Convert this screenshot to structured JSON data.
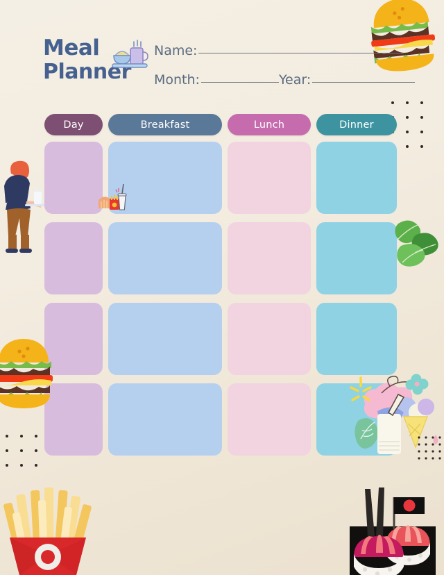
{
  "page": {
    "background_color": "#f2ece0",
    "title_color": "#46618f",
    "label_color": "#5a6b80",
    "rule_color": "#6a6f78"
  },
  "header": {
    "title_line1": "Meal",
    "title_line2": "Planner",
    "logo_icon": "breakfast-bowl-mug-icon",
    "fields": [
      {
        "label": "Name:",
        "value": ""
      },
      {
        "label": "Month:",
        "value": ""
      },
      {
        "label": "Year:",
        "value": ""
      }
    ]
  },
  "table": {
    "columns": [
      {
        "label": "Day",
        "color": "#7d4f72"
      },
      {
        "label": "Breakfast",
        "color": "#5a7898"
      },
      {
        "label": "Lunch",
        "color": "#c56bae"
      },
      {
        "label": "Dinner",
        "color": "#3d93a0"
      }
    ],
    "cell_colors": [
      "#d7bcdd",
      "#b5cfee",
      "#f2d3e0",
      "#8ed2e4"
    ],
    "row_count": 4,
    "rows": [
      {
        "day": "",
        "breakfast": "",
        "lunch": "",
        "dinner": ""
      },
      {
        "day": "",
        "breakfast": "",
        "lunch": "",
        "dinner": ""
      },
      {
        "day": "",
        "breakfast": "",
        "lunch": "",
        "dinner": ""
      },
      {
        "day": "",
        "breakfast": "",
        "lunch": "",
        "dinner": ""
      }
    ]
  },
  "decorations": [
    {
      "name": "burger-illustration-top-right"
    },
    {
      "name": "burger-illustration-left"
    },
    {
      "name": "waiter-illustration"
    },
    {
      "name": "spinach-leaves-illustration"
    },
    {
      "name": "ice-cream-milkshake-illustration"
    },
    {
      "name": "french-fries-illustration"
    },
    {
      "name": "sushi-illustration"
    },
    {
      "name": "fries-drink-mini-icon"
    },
    {
      "name": "dot-grid-top-right"
    },
    {
      "name": "dot-grid-bottom-left"
    }
  ]
}
